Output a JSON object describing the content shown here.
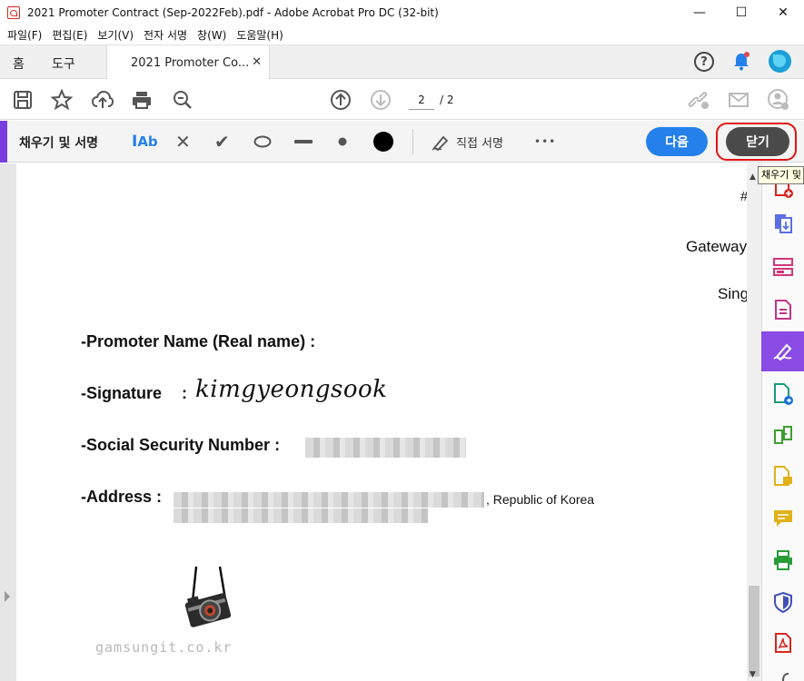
{
  "window": {
    "title": "2021 Promoter Contract (Sep-2022Feb).pdf - Adobe Acrobat Pro DC (32-bit)",
    "minimize": "—",
    "maximize": "☐",
    "close": "✕"
  },
  "menu": [
    "파일(F)",
    "편집(E)",
    "보기(V)",
    "전자 서명",
    "창(W)",
    "도움말(H)"
  ],
  "tabs": {
    "home": "홈",
    "tools": "도구",
    "document": "2021 Promoter Co...",
    "document_close": "✕"
  },
  "toolbar": {
    "current_page": "2",
    "page_total": "/ 2"
  },
  "fill_sign": {
    "title": "채우기 및 서명",
    "text_tool": "Ab",
    "direct_sign": "직접 서명",
    "more": "•••",
    "next_label": "다음",
    "close_label": "닫기",
    "tooltip": "채우기 및"
  },
  "document": {
    "right_fragments": [
      "#",
      "Gateway",
      "Sing"
    ],
    "fields": {
      "promoter_name": "-Promoter Name (Real name) :",
      "signature_label": "-Signature",
      "signature_colon": ":",
      "signature_value": "kimgyeongsook",
      "ssn_label": "-Social Security Number :",
      "address_label": "-Address :",
      "address_tail": ", Republic of Korea"
    },
    "watermark": "gamsungit.co.kr"
  },
  "colors": {
    "accent_purple": "#7a3ee0",
    "next_blue": "#2680eb",
    "close_dark": "#4a4a4a",
    "highlight_red": "#e21212"
  }
}
